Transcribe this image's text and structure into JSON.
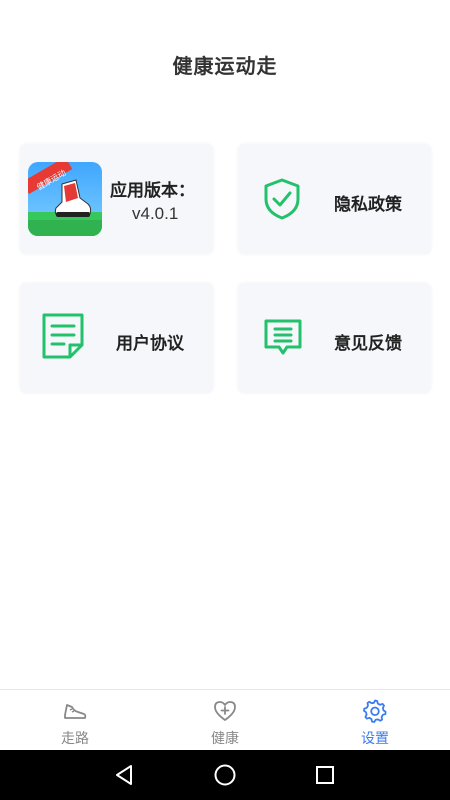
{
  "app": {
    "title": "健康运动走"
  },
  "cards": {
    "version": {
      "label": "应用版本：",
      "value": "v4.0.1",
      "logo_text": "健康运动"
    },
    "privacy": {
      "label": "隐私政策"
    },
    "agreement": {
      "label": "用户协议"
    },
    "feedback": {
      "label": "意见反馈"
    }
  },
  "bottom_nav": {
    "items": [
      {
        "label": "走路",
        "icon": "shoe-icon"
      },
      {
        "label": "健康",
        "icon": "heart-plus-icon"
      },
      {
        "label": "设置",
        "icon": "gear-icon",
        "active": true
      }
    ]
  },
  "colors": {
    "accent_green": "#23c16b",
    "active_blue": "#3b7cf0",
    "inactive_gray": "#888888",
    "card_bg": "#f6f7fb"
  }
}
